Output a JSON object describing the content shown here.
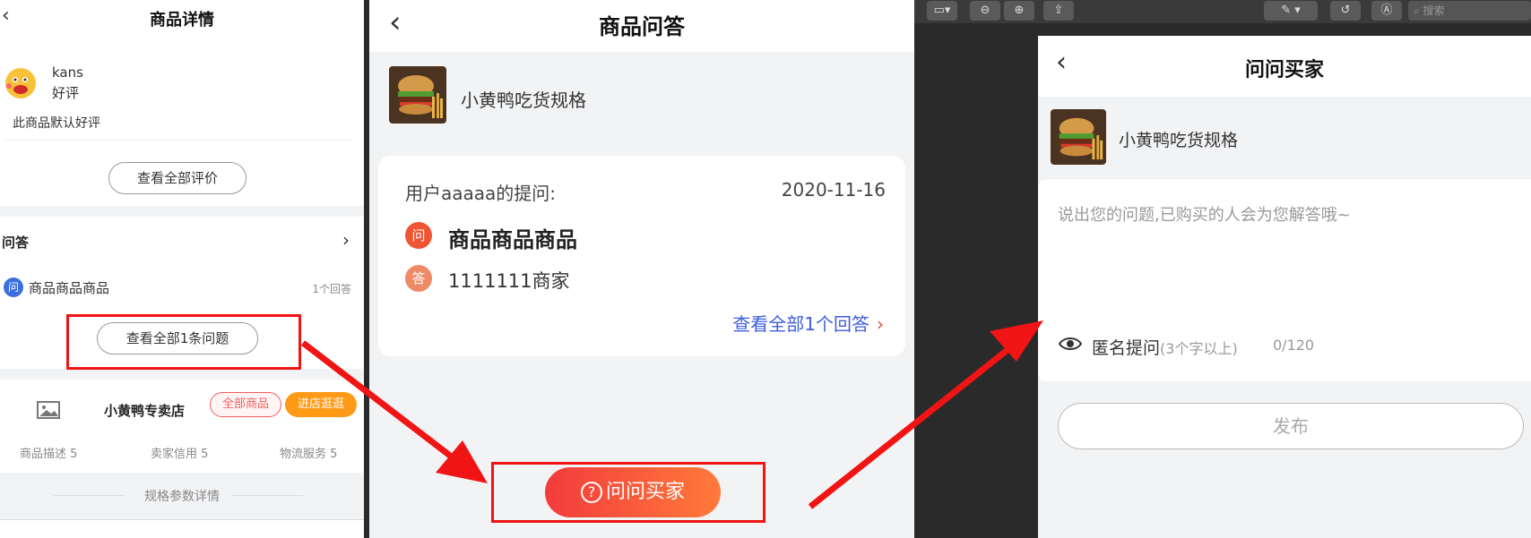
{
  "panel1": {
    "title": "商品详情",
    "review": {
      "user": "kans",
      "rating": "好评",
      "comment": "此商品默认好评",
      "all_reviews_label": "查看全部评价"
    },
    "qa": {
      "section_title": "问答",
      "q_badge": "问",
      "question": "商品商品商品",
      "answer_count": "1个回答",
      "all_questions_label": "查看全部1条问题"
    },
    "store": {
      "name": "小黄鸭专卖店",
      "all_goods_label": "全部商品",
      "visit_label": "进店逛逛",
      "scores": [
        "商品描述 5",
        "卖家信用 5",
        "物流服务 5"
      ]
    },
    "spec_label": "规格参数详情"
  },
  "panel2": {
    "title": "商品问答",
    "product_name": "小黄鸭吃货规格",
    "asker": "用户aaaaa的提问:",
    "date": "2020-11-16",
    "q_badge": "问",
    "question": "商品商品商品",
    "a_badge": "答",
    "answer": "1111111商家",
    "all_answers_label": "查看全部1个回答",
    "ask_button_label": "问问买家",
    "ask_button_icon": "?"
  },
  "toolbar": {
    "search_placeholder": "搜索"
  },
  "panel3": {
    "title": "问问买家",
    "product_name": "小黄鸭吃货规格",
    "placeholder": "说出您的问题,已购买的人会为您解答哦~",
    "anonymous_label": "匿名提问",
    "anonymous_hint": "(3个字以上)",
    "char_count": "0/120",
    "publish_label": "发布"
  },
  "colors": {
    "accent_red": "#f01414",
    "ask_gradient_start": "#f23c3c",
    "ask_gradient_end": "#ff7a3a",
    "link_blue": "#3d5de0",
    "visit_orange": "#ff9a16"
  }
}
